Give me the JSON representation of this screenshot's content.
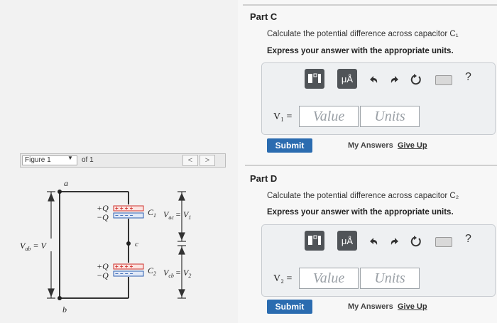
{
  "partC": {
    "title": "Part C",
    "instruction": "Calculate the potential difference across capacitor C₁",
    "express": "Express your answer with the appropriate units.",
    "variable": "V₁ =",
    "value_placeholder": "Value",
    "units_placeholder": "Units",
    "submit": "Submit",
    "my_answers": "My Answers",
    "give_up": "Give Up"
  },
  "partD": {
    "title": "Part D",
    "instruction": "Calculate the potential difference across capacitor C₂",
    "express": "Express your answer with the appropriate units.",
    "variable": "V₂ =",
    "value_placeholder": "Value",
    "units_placeholder": "Units",
    "submit": "Submit",
    "my_answers": "My Answers",
    "give_up": "Give Up"
  },
  "toolbar": {
    "units_label": "μÅ",
    "help": "?",
    "icons": [
      "templates-icon",
      "units-icon",
      "undo-icon",
      "redo-icon",
      "reset-icon",
      "keyboard-icon",
      "help-icon"
    ]
  },
  "figure": {
    "selector": "Figure 1",
    "of": "of 1",
    "prev": "<",
    "next": ">",
    "labels": {
      "a": "a",
      "b": "b",
      "c": "c",
      "vab": "V",
      "vab_sub": "ab",
      "vab_eq": "= V",
      "q_plus": "+Q",
      "q_minus": "−Q",
      "c1": "C",
      "c1_sub": "1",
      "c2": "C",
      "c2_sub": "2",
      "vac": "V",
      "vac_sub": "ac",
      "vac_eq": "= V",
      "vac_rhs_sub": "1",
      "vcb": "V",
      "vcb_sub": "cb",
      "vcb_eq": "= V",
      "vcb_rhs_sub": "2",
      "plates_plus": "+ + + +",
      "plates_minus": "− − − −"
    }
  },
  "colors": {
    "accent": "#2b6cb0",
    "plus_plate": "#d0312d",
    "minus_plate": "#2d5fb0"
  }
}
